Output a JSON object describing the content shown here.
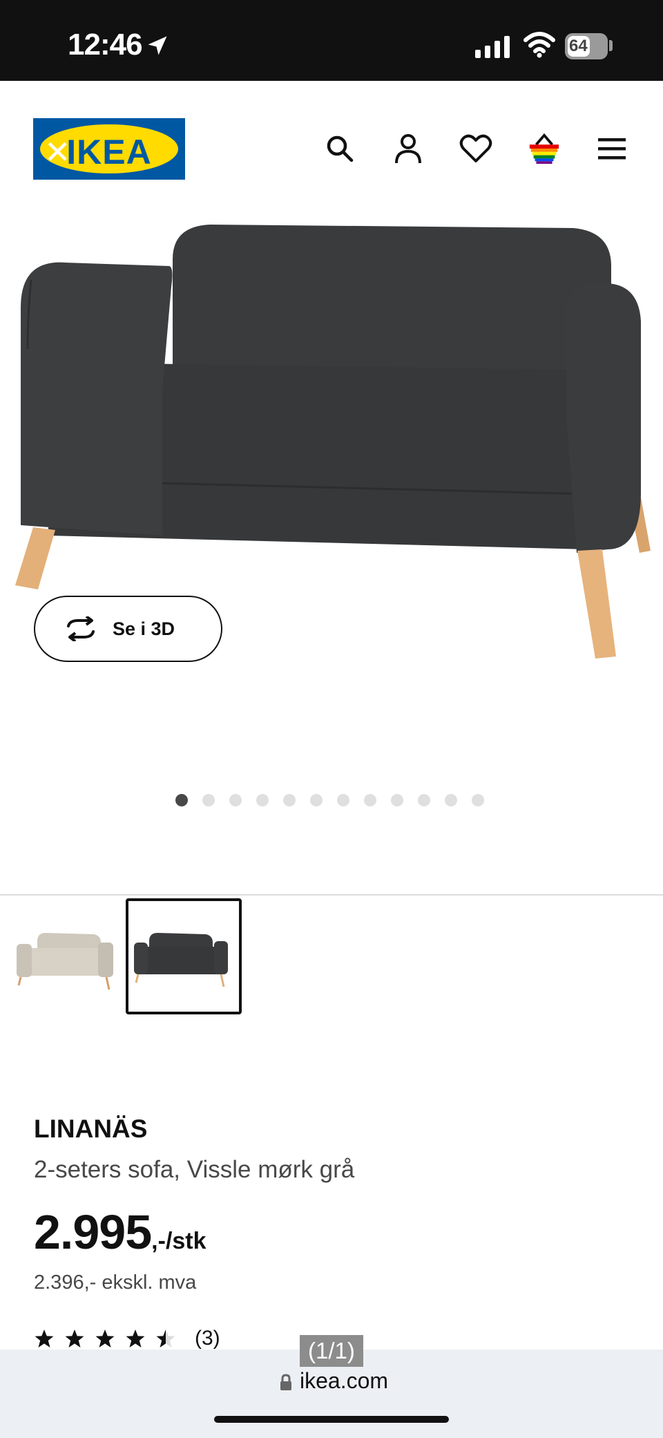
{
  "status_bar": {
    "time": "12:46",
    "battery": "64",
    "icons": [
      "location-arrow-icon",
      "signal-icon",
      "wifi-icon",
      "battery-icon"
    ]
  },
  "header": {
    "logo_text": "IKEA",
    "icons": [
      "search-icon",
      "profile-icon",
      "heart-icon",
      "basket-icon",
      "menu-icon"
    ]
  },
  "gallery": {
    "view_3d_label": "Se i 3D",
    "dot_count": 12,
    "active_dot": 1,
    "thumbnails": [
      {
        "name": "beige-variant",
        "selected": false
      },
      {
        "name": "dark-grey-variant",
        "selected": true
      }
    ]
  },
  "product": {
    "name": "LINANÄS",
    "description": "2-seters sofa, Vissle mørk grå",
    "price": "2.995",
    "price_unit": ",-/stk",
    "price_ex_vat": "2.396,- ekskl. mva",
    "rating": 4.5,
    "rating_count": "(3)"
  },
  "browser": {
    "page_indicator": "(1/1)",
    "url": "ikea.com"
  },
  "colors": {
    "ikea_blue": "#0058a3",
    "ikea_yellow": "#ffdb00",
    "sofa": "#3b3c3e",
    "legs": "#e3b07a"
  }
}
